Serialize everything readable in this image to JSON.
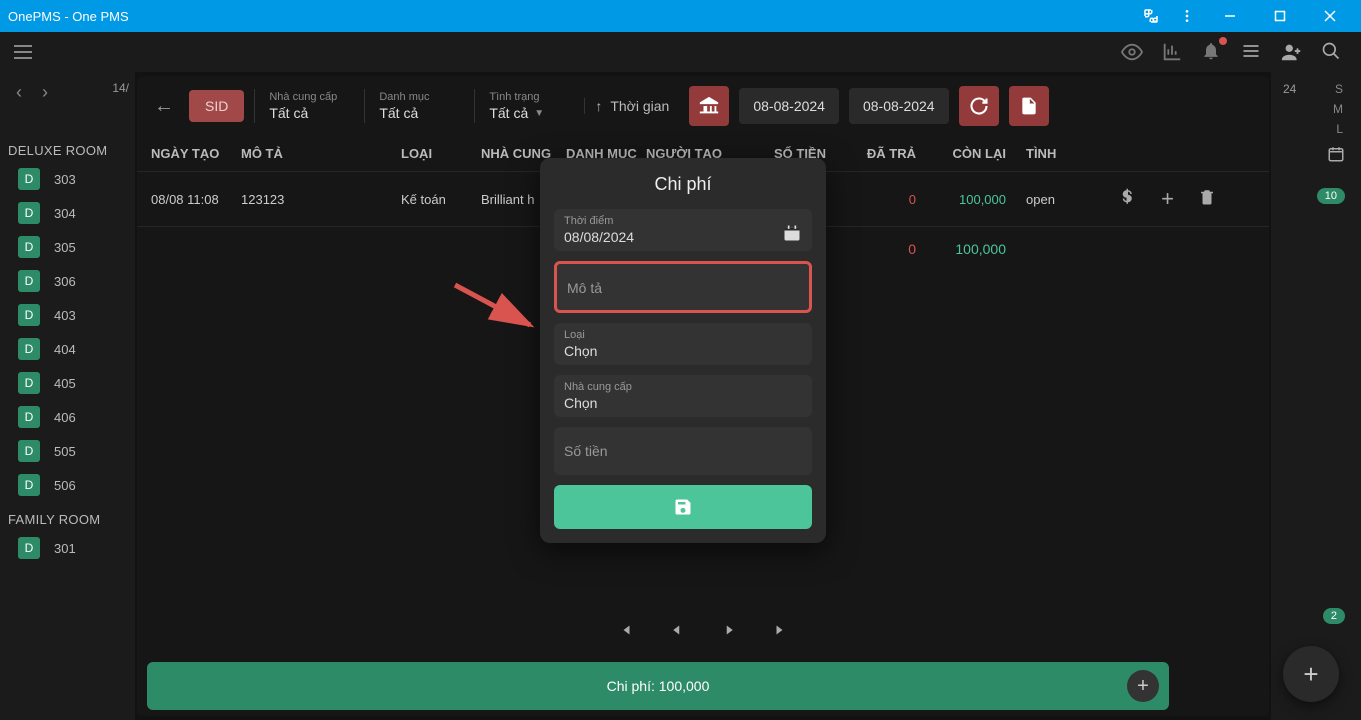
{
  "window": {
    "title": "OnePMS - One PMS"
  },
  "sidebar": {
    "date": "14/",
    "groups": [
      {
        "name": "DELUXE ROOM",
        "rooms": [
          "303",
          "304",
          "305",
          "306",
          "403",
          "404",
          "405",
          "406",
          "505",
          "506"
        ]
      },
      {
        "name": "FAMILY ROOM",
        "rooms": [
          "301"
        ]
      }
    ]
  },
  "toolbar": {
    "sid": "SID",
    "nhacungcap": {
      "lbl": "Nhà cung cấp",
      "val": "Tất cả"
    },
    "danhmuc": {
      "lbl": "Danh mục",
      "val": "Tất cả"
    },
    "tinhtrang": {
      "lbl": "Tình trạng",
      "val": "Tất cả"
    },
    "thoigian": "Thời gian",
    "date_from": "08-08-2024",
    "date_to": "08-08-2024"
  },
  "table": {
    "head": {
      "ngaytao": "NGÀY TẠO",
      "mota": "MÔ TẢ",
      "loai": "LOẠI",
      "nhacung": "NHÀ CUNG",
      "danhmuc": "DANH MỤC",
      "nguoitao": "NGƯỜI TẠO",
      "sotien": "SỐ TIỀN",
      "datra": "ĐÃ TRẢ",
      "conlai": "CÒN LẠI",
      "tinh": "TÌNH"
    },
    "rows": [
      {
        "ngaytao": "08/08 11:08",
        "mota": "123123",
        "loai": "Kế toán",
        "nhacung": "Brilliant h",
        "danhmuc": "",
        "nguoitao": "",
        "sotien": "",
        "datra": "0",
        "conlai": "100,000",
        "tinh": "open"
      }
    ],
    "sum": {
      "datra": "0",
      "conlai": "100,000"
    }
  },
  "bottom": {
    "text": "Chi phí: 100,000"
  },
  "rail": {
    "date": "24",
    "pill1": "10",
    "pill2": "2",
    "letters": [
      "S",
      "M",
      "L"
    ]
  },
  "modal": {
    "title": "Chi phí",
    "thoidiem": {
      "lbl": "Thời điểm",
      "val": "08/08/2024"
    },
    "mota_ph": "Mô tả",
    "loai": {
      "lbl": "Loại",
      "val": "Chọn"
    },
    "nhacungcap": {
      "lbl": "Nhà cung cấp",
      "val": "Chọn"
    },
    "sotien_ph": "Số tiền"
  }
}
